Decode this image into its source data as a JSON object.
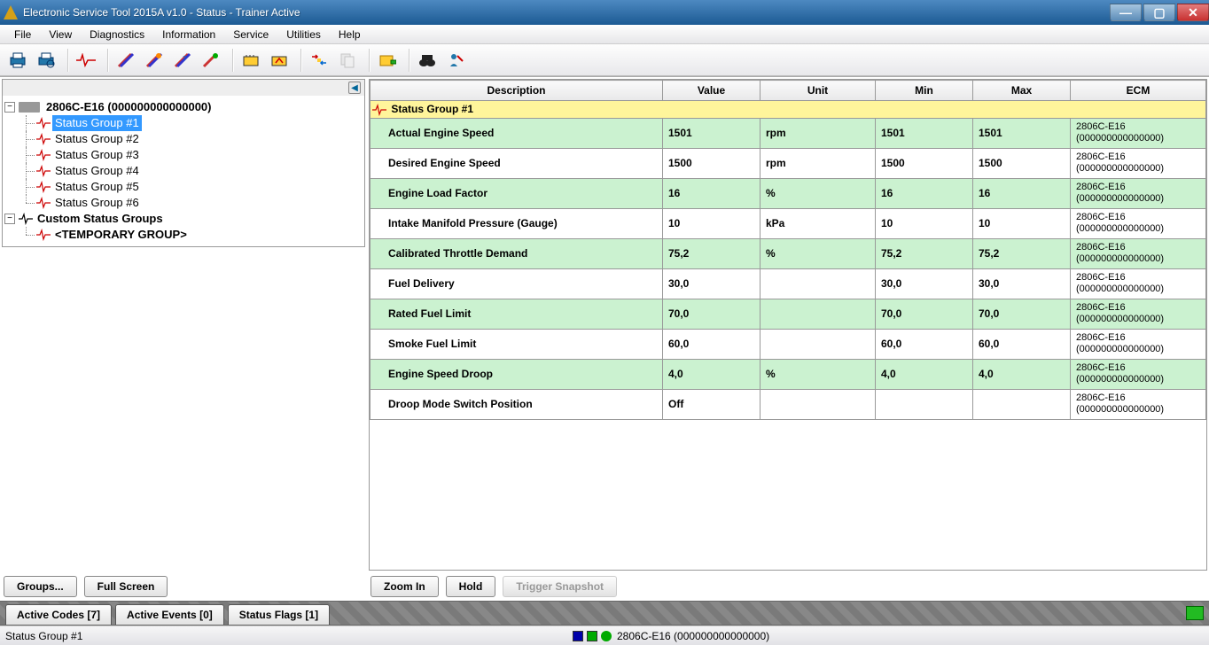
{
  "titlebar": {
    "title": "Electronic Service Tool 2015A v1.0 - Status - Trainer Active"
  },
  "menu": [
    "File",
    "View",
    "Diagnostics",
    "Information",
    "Service",
    "Utilities",
    "Help"
  ],
  "sidebar": {
    "root": "2806C-E16 (000000000000000)",
    "groups": [
      "Status Group #1",
      "Status Group #2",
      "Status Group #3",
      "Status Group #4",
      "Status Group #5",
      "Status Group #6"
    ],
    "custom_label": "Custom Status Groups",
    "temp_label": "<TEMPORARY GROUP>"
  },
  "table": {
    "headers": [
      "Description",
      "Value",
      "Unit",
      "Min",
      "Max",
      "ECM"
    ],
    "group_label": "Status Group #1",
    "ecm_line1": "2806C-E16",
    "ecm_line2": "(000000000000000)",
    "rows": [
      {
        "desc": "Actual Engine Speed",
        "value": "1501",
        "unit": "rpm",
        "min": "1501",
        "max": "1501",
        "cls": "green"
      },
      {
        "desc": "Desired Engine Speed",
        "value": "1500",
        "unit": "rpm",
        "min": "1500",
        "max": "1500",
        "cls": "white"
      },
      {
        "desc": "Engine Load Factor",
        "value": "16",
        "unit": "%",
        "min": "16",
        "max": "16",
        "cls": "green"
      },
      {
        "desc": "Intake Manifold Pressure (Gauge)",
        "value": "10",
        "unit": "kPa",
        "min": "10",
        "max": "10",
        "cls": "white"
      },
      {
        "desc": "Calibrated Throttle Demand",
        "value": "75,2",
        "unit": "%",
        "min": "75,2",
        "max": "75,2",
        "cls": "green"
      },
      {
        "desc": "Fuel Delivery",
        "value": "30,0",
        "unit": "",
        "min": "30,0",
        "max": "30,0",
        "cls": "white"
      },
      {
        "desc": "Rated Fuel Limit",
        "value": "70,0",
        "unit": "",
        "min": "70,0",
        "max": "70,0",
        "cls": "green"
      },
      {
        "desc": "Smoke Fuel Limit",
        "value": "60,0",
        "unit": "",
        "min": "60,0",
        "max": "60,0",
        "cls": "white"
      },
      {
        "desc": "Engine Speed Droop",
        "value": "4,0",
        "unit": "%",
        "min": "4,0",
        "max": "4,0",
        "cls": "green"
      },
      {
        "desc": "Droop Mode Switch Position",
        "value": "Off",
        "unit": "",
        "min": "",
        "max": "",
        "cls": "white"
      }
    ]
  },
  "buttons": {
    "groups": "Groups...",
    "fullscreen": "Full Screen",
    "zoomin": "Zoom In",
    "hold": "Hold",
    "trigger": "Trigger Snapshot"
  },
  "tabs": [
    "Active Codes [7]",
    "Active Events [0]",
    "Status Flags [1]"
  ],
  "statusbar": {
    "left": "Status Group #1",
    "right": "2806C-E16 (000000000000000)"
  }
}
